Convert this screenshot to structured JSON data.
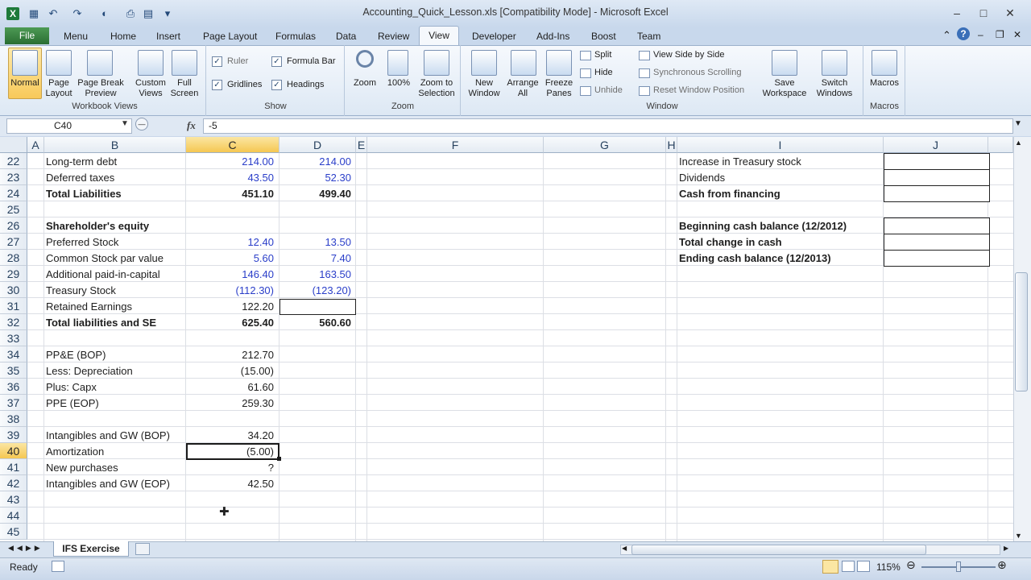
{
  "window": {
    "title": "Accounting_Quick_Lesson.xls  [Compatibility Mode]  -  Microsoft Excel"
  },
  "tabs": [
    "File",
    "Menu",
    "Home",
    "Insert",
    "Page Layout",
    "Formulas",
    "Data",
    "Review",
    "View",
    "Developer",
    "Add-Ins",
    "Boost",
    "Team"
  ],
  "ribbon": {
    "workbook_views": {
      "label": "Workbook Views",
      "normal": "Normal",
      "page_layout": "Page Layout",
      "page_break": "Page Break Preview",
      "custom": "Custom Views",
      "full": "Full Screen"
    },
    "show": {
      "label": "Show",
      "ruler": "Ruler",
      "formula_bar": "Formula Bar",
      "gridlines": "Gridlines",
      "headings": "Headings"
    },
    "zoom": {
      "label": "Zoom",
      "zoom": "Zoom",
      "hundred": "100%",
      "zoom_sel": "Zoom to Selection"
    },
    "window": {
      "label": "Window",
      "new": "New Window",
      "arrange": "Arrange All",
      "freeze": "Freeze Panes",
      "split": "Split",
      "hide": "Hide",
      "unhide": "Unhide",
      "side": "View Side by Side",
      "sync": "Synchronous Scrolling",
      "reset": "Reset Window Position",
      "save_ws": "Save Workspace",
      "switch": "Switch Windows"
    },
    "macros": {
      "label": "Macros",
      "macros": "Macros"
    }
  },
  "formula_bar": {
    "name_box": "C40",
    "fx": "fx",
    "value": "-5"
  },
  "columns": [
    "A",
    "B",
    "C",
    "D",
    "E",
    "F",
    "G",
    "H",
    "I",
    "J"
  ],
  "rows": [
    "22",
    "23",
    "24",
    "25",
    "26",
    "27",
    "28",
    "29",
    "30",
    "31",
    "32",
    "33",
    "34",
    "35",
    "36",
    "37",
    "38",
    "39",
    "40",
    "41",
    "42",
    "43",
    "44",
    "45"
  ],
  "cells": {
    "b22": "Long-term debt",
    "c22": "214.00",
    "d22": "214.00",
    "b23": "Deferred taxes",
    "c23": "43.50",
    "d23": "52.30",
    "b24": "Total Liabilities",
    "c24": "451.10",
    "d24": "499.40",
    "b26": "Shareholder's equity",
    "b27": "Preferred Stock",
    "c27": "12.40",
    "d27": "13.50",
    "b28": "Common Stock par value",
    "c28": "5.60",
    "d28": "7.40",
    "b29": "Additional paid-in-capital",
    "c29": "146.40",
    "d29": "163.50",
    "b30": "Treasury Stock",
    "c30": "(112.30)",
    "d30": "(123.20)",
    "b31": "Retained Earnings",
    "c31": "122.20",
    "b32": "Total liabilities and SE",
    "c32": "625.40",
    "d32": "560.60",
    "b34": "PP&E (BOP)",
    "c34": "212.70",
    "b35": "Less: Depreciation",
    "c35": "(15.00)",
    "b36": "Plus: Capx",
    "c36": "61.60",
    "b37": "PPE (EOP)",
    "c37": "259.30",
    "b39": "Intangibles and GW (BOP)",
    "c39": "34.20",
    "b40": "Amortization",
    "c40": "(5.00)",
    "b41": "New purchases",
    "c41": "?",
    "b42": "Intangibles and GW (EOP)",
    "c42": "42.50",
    "i22": "Increase in Treasury stock",
    "i23": "Dividends",
    "i24": "Cash from financing",
    "i26": "Beginning cash balance (12/2012)",
    "i27": "Total change in cash",
    "i28": "Ending cash balance (12/2013)"
  },
  "sheet_tab": "IFS Exercise",
  "status": {
    "ready": "Ready",
    "zoom": "115%"
  },
  "colors": {
    "ribbon_bg": "#dde8f4",
    "file_tab": "#2a6e33",
    "selected_header": "#f5c752",
    "blue_text": "#2a3ec9"
  }
}
